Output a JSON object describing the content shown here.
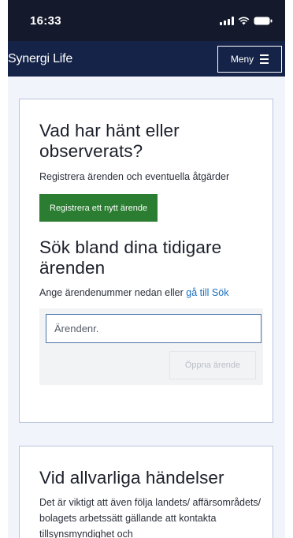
{
  "status_bar": {
    "time": "16:33",
    "icons": [
      "signal-icon",
      "wifi-icon",
      "battery-icon"
    ]
  },
  "header": {
    "app_title": "Synergi Life",
    "menu_label": "Meny"
  },
  "section_report": {
    "title": "Vad har hänt eller observerats?",
    "subtitle": "Registrera ärenden och eventuella åtgärder",
    "register_button": "Registrera ett nytt ärende"
  },
  "section_search": {
    "title": "Sök bland dina tidigare ärenden",
    "instruction": "Ange ärendenummer nedan eller",
    "search_link": "gå till Sök",
    "case_input_placeholder": "Ärendenr.",
    "case_input_value": "",
    "open_button": "Öppna ärende"
  },
  "section_serious": {
    "title": "Vid allvarliga händelser",
    "text": "Det är viktigt att även följa landets/ affärsområdets/ bolagets arbetssätt gällande att kontakta tillsynsmyndighet och"
  },
  "colors": {
    "status_bar": "#141a2b",
    "header": "#152348",
    "primary_button": "#2a7d31",
    "link": "#1a6fc1",
    "page_background": "#f1f4fa"
  }
}
